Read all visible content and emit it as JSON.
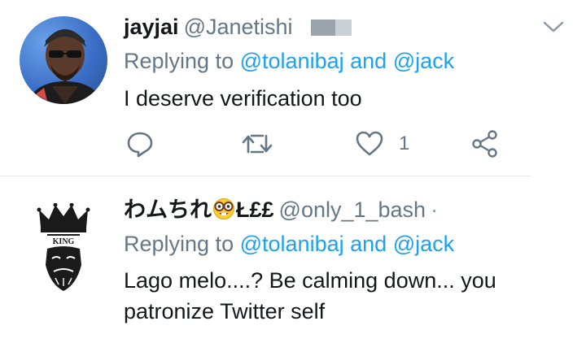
{
  "tweets": [
    {
      "display_name": "jayjai",
      "handle": "@Janetishi",
      "replying_prefix": "Replying to",
      "mention_1": "@tolanibaj",
      "and_word": "and",
      "mention_2": "@jack",
      "text": "I deserve verification too",
      "like_count": "1"
    },
    {
      "display_name_prefix": "わムちれ",
      "display_name_emoji": "nerd-face-emoji",
      "display_name_suffix": "Ł££",
      "handle": "@only_1_bash",
      "separator": "·",
      "replying_prefix": "Replying to",
      "mention_1": "@tolanibaj",
      "and_word": "and",
      "mention_2": "@jack",
      "text_line_1": "Lago melo....? Be calming down... you",
      "text_line_2": "patronize Twitter self"
    }
  ],
  "icons": [
    "chevron-down-icon",
    "reply-icon",
    "retweet-icon",
    "like-icon",
    "share-icon"
  ],
  "colors": {
    "link": "#1da1f2",
    "secondary_text": "#657786",
    "primary_text": "#14171a",
    "divider": "#e1e8ed"
  }
}
